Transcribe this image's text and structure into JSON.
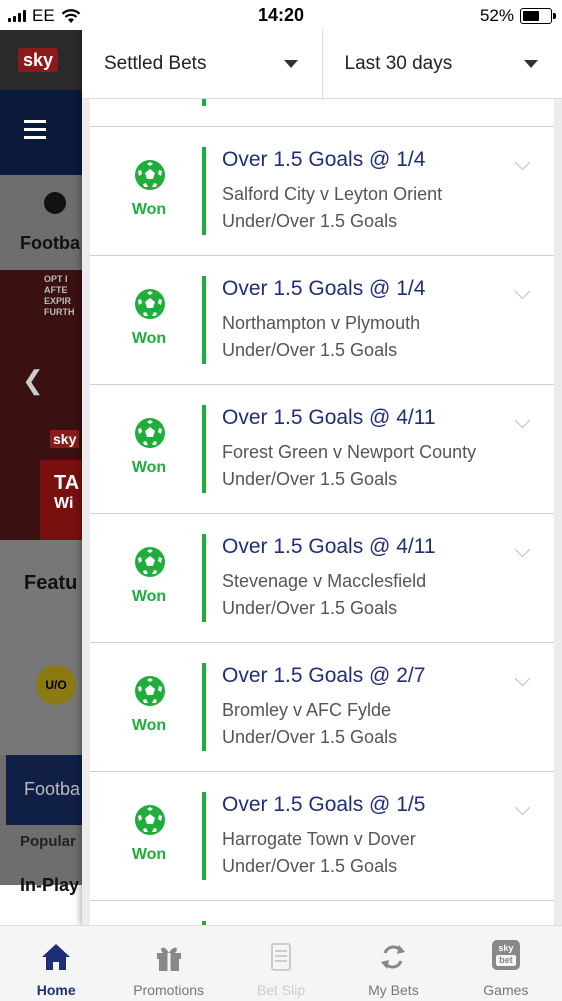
{
  "status_bar": {
    "carrier": "EE",
    "time": "14:20",
    "battery": "52%",
    "battery_level": 0.52
  },
  "background": {
    "brand_logo": "sky",
    "nav_label": "Footba",
    "promo_text": [
      "OPT I",
      "AFTE",
      "EXPIR",
      "FURTH"
    ],
    "promo_badge": "sky",
    "promo_title": "TA",
    "promo_sub": "Wi",
    "featured_label": "Featu",
    "uo_badge": "U/O",
    "football_label": "Footba",
    "popular_label": "Popular",
    "inplay_label": "In-Play"
  },
  "filters": {
    "type": "Settled Bets",
    "period": "Last 30 days"
  },
  "bets": [
    {
      "selection": "Over 1.5 Goals @ 1/4",
      "match": "Salford City v Leyton Orient",
      "market": "Under/Over 1.5 Goals",
      "result": "Won"
    },
    {
      "selection": "Over 1.5 Goals @ 1/4",
      "match": "Northampton v Plymouth",
      "market": "Under/Over 1.5 Goals",
      "result": "Won"
    },
    {
      "selection": "Over 1.5 Goals @ 4/11",
      "match": "Forest Green v Newport County",
      "market": "Under/Over 1.5 Goals",
      "result": "Won"
    },
    {
      "selection": "Over 1.5 Goals @ 4/11",
      "match": "Stevenage v Macclesfield",
      "market": "Under/Over 1.5 Goals",
      "result": "Won"
    },
    {
      "selection": "Over 1.5 Goals @ 2/7",
      "match": "Bromley v AFC Fylde",
      "market": "Under/Over 1.5 Goals",
      "result": "Won"
    },
    {
      "selection": "Over 1.5 Goals @ 1/5",
      "match": "Harrogate Town v Dover",
      "market": "Under/Over 1.5 Goals",
      "result": "Won"
    }
  ],
  "tabs": [
    {
      "label": "Home",
      "icon": "home-icon"
    },
    {
      "label": "Promotions",
      "icon": "gift-icon"
    },
    {
      "label": "Bet Slip",
      "icon": "betslip-icon"
    },
    {
      "label": "My Bets",
      "icon": "mybets-icon"
    },
    {
      "label": "Games",
      "icon": "games-icon"
    }
  ],
  "games_icon_text": [
    "sky",
    "bet"
  ],
  "colors": {
    "won_green": "#1fae3b",
    "selection_blue": "#1e2f78",
    "active_tab": "#1e2f78"
  }
}
